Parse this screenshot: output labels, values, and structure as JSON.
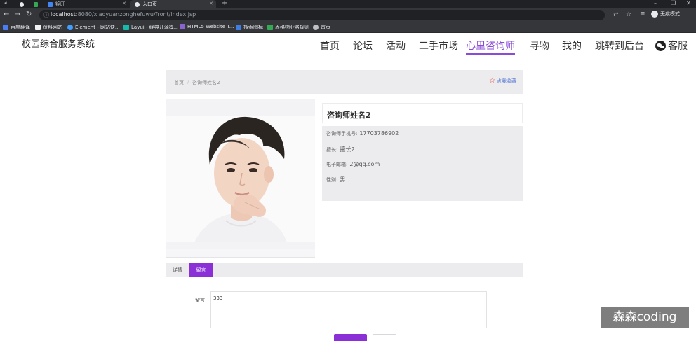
{
  "browser": {
    "tabs": [
      {
        "label": "",
        "color": "#34a853"
      },
      {
        "label": "锦旺",
        "color": "#4285f4"
      },
      {
        "label": "入口页",
        "color": "#e8eaed"
      }
    ],
    "url_host": "localhost",
    "url_rest": ":8080/xiaoyuanzonghefuwu/front/index.jsp",
    "incognito_label": "无痕模式",
    "bookmarks": [
      {
        "label": "百度翻译",
        "color": "#4a7cf3"
      },
      {
        "label": "资料网站",
        "color": "#f2f2f2"
      },
      {
        "label": "Element - 网站快...",
        "color": "#409eff"
      },
      {
        "label": "Layui - 经典开源模...",
        "color": "#16baaa"
      },
      {
        "label": "HTML5 Website T...",
        "color": "#8a63d2"
      },
      {
        "label": "搜索图标",
        "color": "#3f7de0"
      },
      {
        "label": "表格物业名规则",
        "color": "#34a853"
      },
      {
        "label": "首页",
        "color": "#bdc1c6"
      }
    ]
  },
  "site": {
    "title": "校园综合服务系统",
    "nav": [
      "首页",
      "论坛",
      "活动",
      "二手市场",
      "心里咨询师",
      "寻物",
      "我的",
      "跳转到后台"
    ],
    "active_nav": "心里咨询师",
    "service_label": "客服",
    "accent_color": "#8b2fd6"
  },
  "breadcrumb": {
    "home": "首页",
    "separator": "/",
    "current": "咨询师姓名2",
    "favorite_label": "点我收藏"
  },
  "consultant": {
    "name": "咨询师姓名2",
    "fields": [
      {
        "label": "咨询师手机号:",
        "value": "17703786902"
      },
      {
        "label": "擅长:",
        "value": "擅长2"
      },
      {
        "label": "电子邮箱:",
        "value": "2@qq.com"
      },
      {
        "label": "性别:",
        "value": "男"
      }
    ]
  },
  "tabs": [
    {
      "label": "详情",
      "active": false
    },
    {
      "label": "留言",
      "active": true
    }
  ],
  "message_form": {
    "label": "留言",
    "value": "333"
  },
  "watermark": "森森coding"
}
